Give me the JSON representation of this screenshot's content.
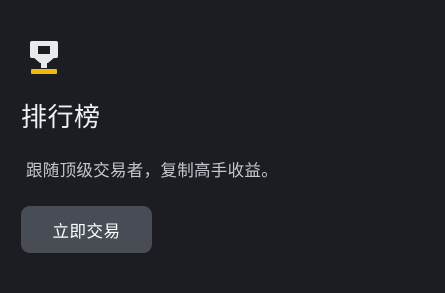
{
  "card": {
    "icon": "trophy-icon",
    "title": "排行榜",
    "description": "跟随顶级交易者，复制高手收益。",
    "cta_label": "立即交易"
  },
  "colors": {
    "background": "#1b1d22",
    "trophy_cup": "#e8e9eb",
    "trophy_base": "#f0b90b",
    "button_bg": "#474c55"
  }
}
